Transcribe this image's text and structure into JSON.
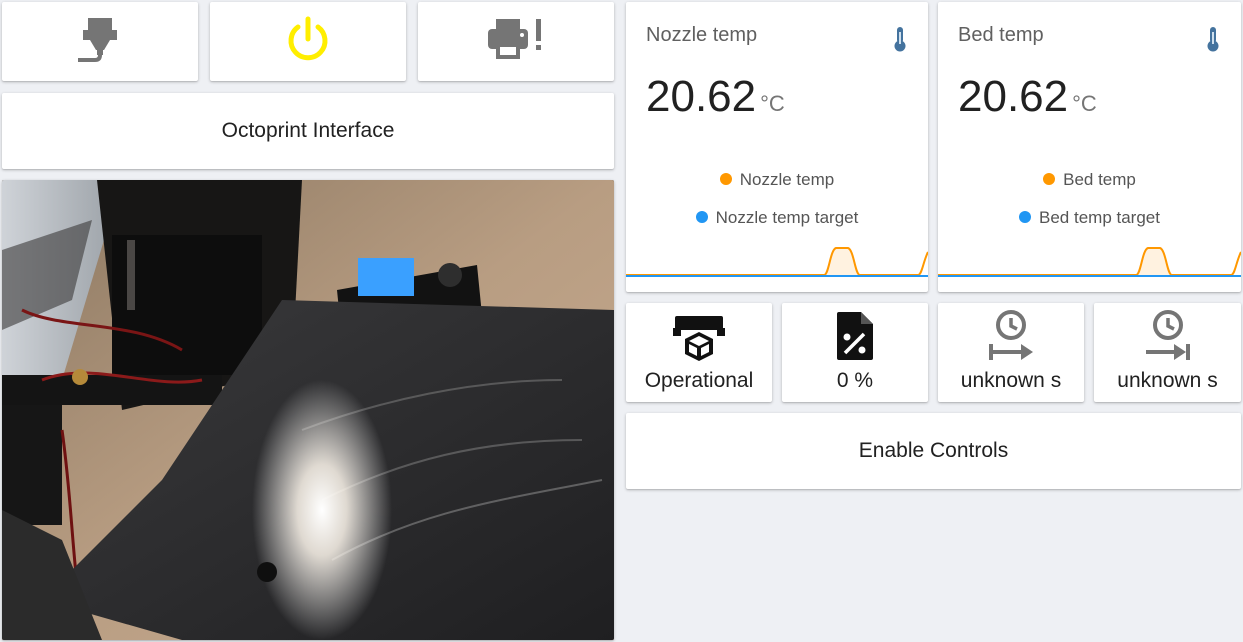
{
  "buttons": [
    {
      "name": "extruder-button",
      "icon": "printer-3d-nozzle-icon",
      "color": "#757575"
    },
    {
      "name": "power-button",
      "icon": "power-icon",
      "color": "#ffee00"
    },
    {
      "name": "printer-alert-button",
      "icon": "printer-alert-icon",
      "color": "#757575"
    }
  ],
  "title_card": {
    "label": "Octoprint Interface"
  },
  "camera": {
    "icon": "printer-bed-photo"
  },
  "sensors": [
    {
      "name": "Nozzle temp",
      "value": "20.62",
      "unit": "°C",
      "icon": "thermometer-icon",
      "icon_color": "#44739e",
      "legend": [
        {
          "label": "Nozzle temp",
          "color": "#ff9800"
        },
        {
          "label": "Nozzle temp target",
          "color": "#2196f3"
        }
      ]
    },
    {
      "name": "Bed temp",
      "value": "20.62",
      "unit": "°C",
      "icon": "thermometer-icon",
      "icon_color": "#44739e",
      "legend": [
        {
          "label": "Bed temp",
          "color": "#ff9800"
        },
        {
          "label": "Bed temp target",
          "color": "#2196f3"
        }
      ]
    }
  ],
  "stats": [
    {
      "label": "Operational",
      "icon": "printer-3d-icon"
    },
    {
      "label": "0 %",
      "icon": "file-percent-icon"
    },
    {
      "label": "unknown s",
      "icon": "clock-start-icon"
    },
    {
      "label": "unknown s",
      "icon": "clock-end-icon"
    }
  ],
  "enable_controls": {
    "label": "Enable Controls"
  }
}
